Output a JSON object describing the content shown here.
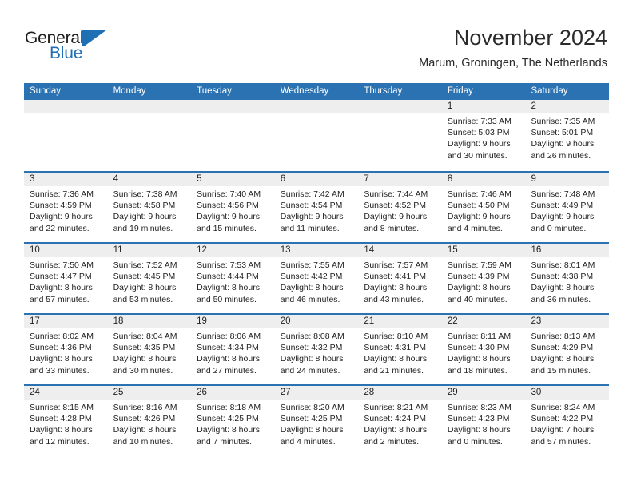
{
  "brand": {
    "name_top": "General",
    "name_bottom": "Blue",
    "accent_color": "#1f6fb5",
    "logo_mark": "triangle-flag-mark"
  },
  "header": {
    "title": "November 2024",
    "subtitle": "Marum, Groningen, The Netherlands"
  },
  "calendar": {
    "header_bg": "#2b72b2",
    "day_strip_bg": "#eeeeee",
    "weekdays": [
      "Sunday",
      "Monday",
      "Tuesday",
      "Wednesday",
      "Thursday",
      "Friday",
      "Saturday"
    ],
    "weeks": [
      [
        {
          "day": "",
          "empty": true
        },
        {
          "day": "",
          "empty": true
        },
        {
          "day": "",
          "empty": true
        },
        {
          "day": "",
          "empty": true
        },
        {
          "day": "",
          "empty": true
        },
        {
          "day": "1",
          "sunrise": "Sunrise: 7:33 AM",
          "sunset": "Sunset: 5:03 PM",
          "daylight": "Daylight: 9 hours and 30 minutes."
        },
        {
          "day": "2",
          "sunrise": "Sunrise: 7:35 AM",
          "sunset": "Sunset: 5:01 PM",
          "daylight": "Daylight: 9 hours and 26 minutes."
        }
      ],
      [
        {
          "day": "3",
          "sunrise": "Sunrise: 7:36 AM",
          "sunset": "Sunset: 4:59 PM",
          "daylight": "Daylight: 9 hours and 22 minutes."
        },
        {
          "day": "4",
          "sunrise": "Sunrise: 7:38 AM",
          "sunset": "Sunset: 4:58 PM",
          "daylight": "Daylight: 9 hours and 19 minutes."
        },
        {
          "day": "5",
          "sunrise": "Sunrise: 7:40 AM",
          "sunset": "Sunset: 4:56 PM",
          "daylight": "Daylight: 9 hours and 15 minutes."
        },
        {
          "day": "6",
          "sunrise": "Sunrise: 7:42 AM",
          "sunset": "Sunset: 4:54 PM",
          "daylight": "Daylight: 9 hours and 11 minutes."
        },
        {
          "day": "7",
          "sunrise": "Sunrise: 7:44 AM",
          "sunset": "Sunset: 4:52 PM",
          "daylight": "Daylight: 9 hours and 8 minutes."
        },
        {
          "day": "8",
          "sunrise": "Sunrise: 7:46 AM",
          "sunset": "Sunset: 4:50 PM",
          "daylight": "Daylight: 9 hours and 4 minutes."
        },
        {
          "day": "9",
          "sunrise": "Sunrise: 7:48 AM",
          "sunset": "Sunset: 4:49 PM",
          "daylight": "Daylight: 9 hours and 0 minutes."
        }
      ],
      [
        {
          "day": "10",
          "sunrise": "Sunrise: 7:50 AM",
          "sunset": "Sunset: 4:47 PM",
          "daylight": "Daylight: 8 hours and 57 minutes."
        },
        {
          "day": "11",
          "sunrise": "Sunrise: 7:52 AM",
          "sunset": "Sunset: 4:45 PM",
          "daylight": "Daylight: 8 hours and 53 minutes."
        },
        {
          "day": "12",
          "sunrise": "Sunrise: 7:53 AM",
          "sunset": "Sunset: 4:44 PM",
          "daylight": "Daylight: 8 hours and 50 minutes."
        },
        {
          "day": "13",
          "sunrise": "Sunrise: 7:55 AM",
          "sunset": "Sunset: 4:42 PM",
          "daylight": "Daylight: 8 hours and 46 minutes."
        },
        {
          "day": "14",
          "sunrise": "Sunrise: 7:57 AM",
          "sunset": "Sunset: 4:41 PM",
          "daylight": "Daylight: 8 hours and 43 minutes."
        },
        {
          "day": "15",
          "sunrise": "Sunrise: 7:59 AM",
          "sunset": "Sunset: 4:39 PM",
          "daylight": "Daylight: 8 hours and 40 minutes."
        },
        {
          "day": "16",
          "sunrise": "Sunrise: 8:01 AM",
          "sunset": "Sunset: 4:38 PM",
          "daylight": "Daylight: 8 hours and 36 minutes."
        }
      ],
      [
        {
          "day": "17",
          "sunrise": "Sunrise: 8:02 AM",
          "sunset": "Sunset: 4:36 PM",
          "daylight": "Daylight: 8 hours and 33 minutes."
        },
        {
          "day": "18",
          "sunrise": "Sunrise: 8:04 AM",
          "sunset": "Sunset: 4:35 PM",
          "daylight": "Daylight: 8 hours and 30 minutes."
        },
        {
          "day": "19",
          "sunrise": "Sunrise: 8:06 AM",
          "sunset": "Sunset: 4:34 PM",
          "daylight": "Daylight: 8 hours and 27 minutes."
        },
        {
          "day": "20",
          "sunrise": "Sunrise: 8:08 AM",
          "sunset": "Sunset: 4:32 PM",
          "daylight": "Daylight: 8 hours and 24 minutes."
        },
        {
          "day": "21",
          "sunrise": "Sunrise: 8:10 AM",
          "sunset": "Sunset: 4:31 PM",
          "daylight": "Daylight: 8 hours and 21 minutes."
        },
        {
          "day": "22",
          "sunrise": "Sunrise: 8:11 AM",
          "sunset": "Sunset: 4:30 PM",
          "daylight": "Daylight: 8 hours and 18 minutes."
        },
        {
          "day": "23",
          "sunrise": "Sunrise: 8:13 AM",
          "sunset": "Sunset: 4:29 PM",
          "daylight": "Daylight: 8 hours and 15 minutes."
        }
      ],
      [
        {
          "day": "24",
          "sunrise": "Sunrise: 8:15 AM",
          "sunset": "Sunset: 4:28 PM",
          "daylight": "Daylight: 8 hours and 12 minutes."
        },
        {
          "day": "25",
          "sunrise": "Sunrise: 8:16 AM",
          "sunset": "Sunset: 4:26 PM",
          "daylight": "Daylight: 8 hours and 10 minutes."
        },
        {
          "day": "26",
          "sunrise": "Sunrise: 8:18 AM",
          "sunset": "Sunset: 4:25 PM",
          "daylight": "Daylight: 8 hours and 7 minutes."
        },
        {
          "day": "27",
          "sunrise": "Sunrise: 8:20 AM",
          "sunset": "Sunset: 4:25 PM",
          "daylight": "Daylight: 8 hours and 4 minutes."
        },
        {
          "day": "28",
          "sunrise": "Sunrise: 8:21 AM",
          "sunset": "Sunset: 4:24 PM",
          "daylight": "Daylight: 8 hours and 2 minutes."
        },
        {
          "day": "29",
          "sunrise": "Sunrise: 8:23 AM",
          "sunset": "Sunset: 4:23 PM",
          "daylight": "Daylight: 8 hours and 0 minutes."
        },
        {
          "day": "30",
          "sunrise": "Sunrise: 8:24 AM",
          "sunset": "Sunset: 4:22 PM",
          "daylight": "Daylight: 7 hours and 57 minutes."
        }
      ]
    ]
  }
}
